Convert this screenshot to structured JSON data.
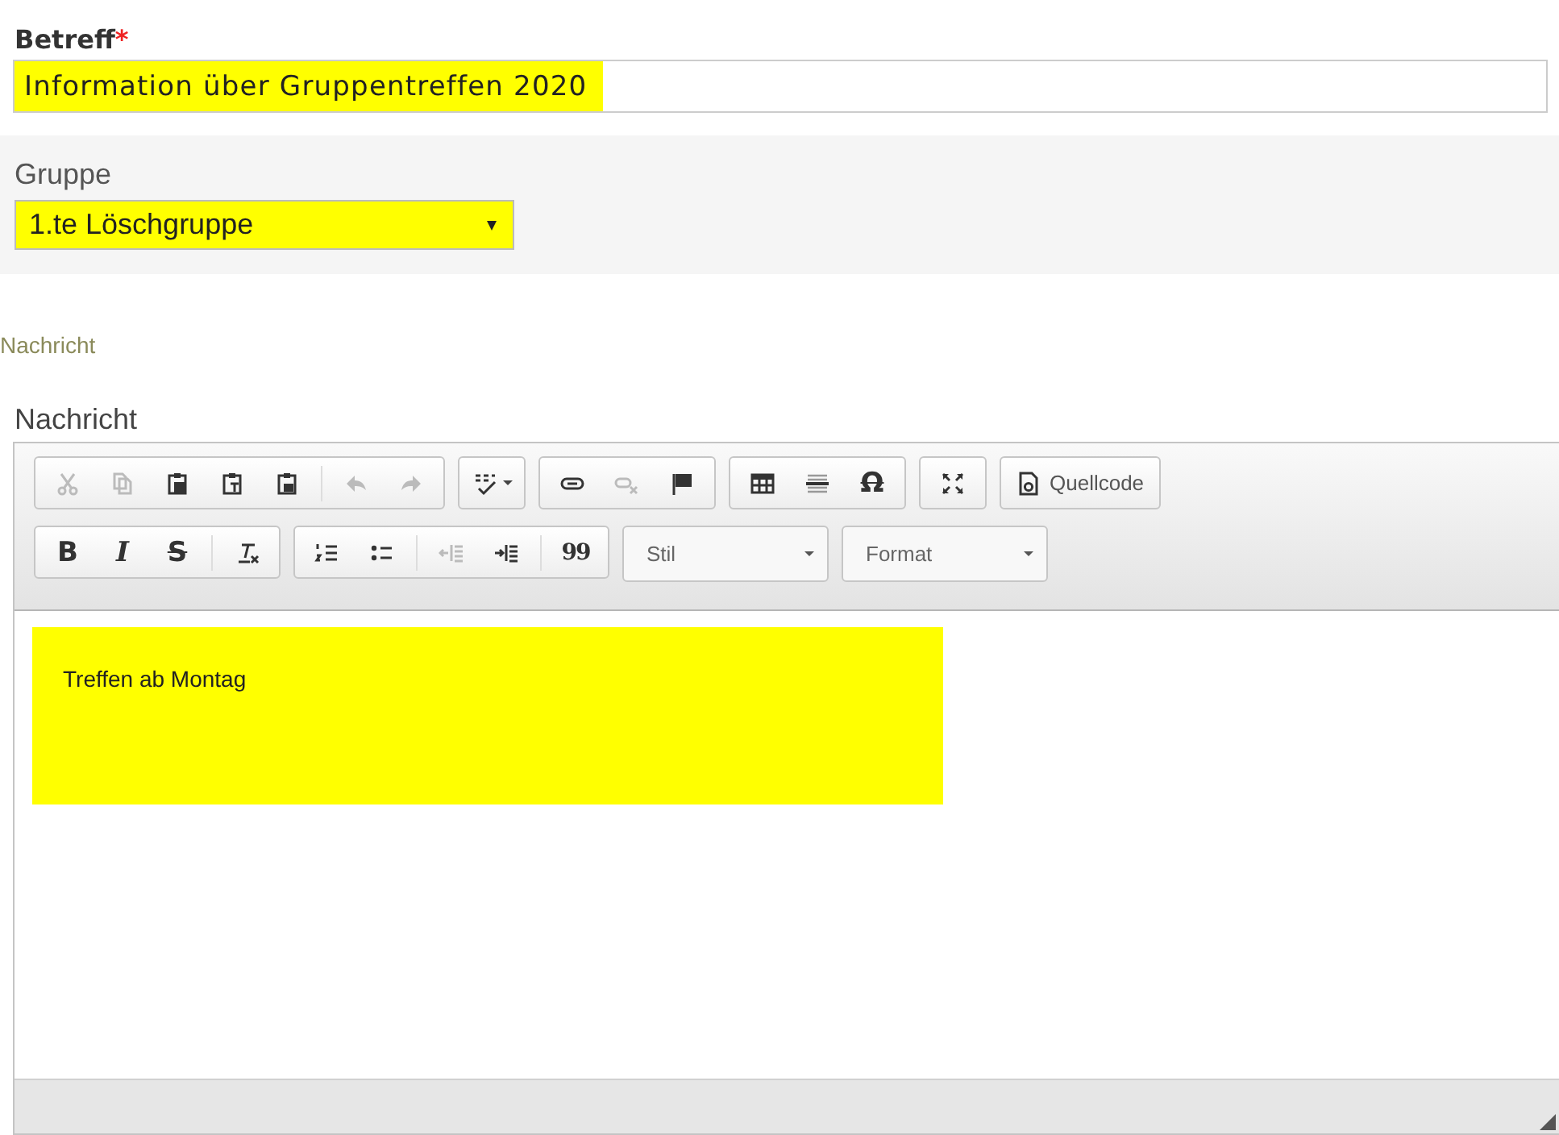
{
  "subject": {
    "label": "Betreff",
    "required_mark": "*",
    "value": "Information über Gruppentreffen 2020",
    "highlighted": true
  },
  "group": {
    "label": "Gruppe",
    "value": "1.te Löschgruppe",
    "highlighted": true
  },
  "section_caption": "Nachricht",
  "editor": {
    "label": "Nachricht",
    "toolbar_rows": [
      [
        [
          {
            "kind": "icon",
            "disabled": true
          },
          {
            "kind": "icon",
            "disabled": true
          },
          {
            "kind": "icon",
            "disabled": false
          },
          {
            "kind": "icon",
            "disabled": false
          },
          {
            "kind": "icon",
            "disabled": false
          },
          {
            "kind": "separator"
          },
          {
            "kind": "icon",
            "disabled": true
          },
          {
            "kind": "icon",
            "disabled": true
          }
        ],
        [
          {
            "kind": "icon",
            "disabled": false
          }
        ],
        [
          {
            "kind": "icon",
            "disabled": false
          },
          {
            "kind": "icon",
            "disabled": true
          },
          {
            "kind": "icon",
            "disabled": false
          }
        ],
        [
          {
            "kind": "icon",
            "disabled": false
          },
          {
            "kind": "icon",
            "disabled": false
          },
          {
            "kind": "letter",
            "label": "Ω",
            "disabled": false
          }
        ],
        [
          {
            "kind": "icon",
            "disabled": false
          }
        ],
        [
          {
            "kind": "labeled",
            "label": "Quellcode",
            "disabled": false
          }
        ]
      ],
      [
        [
          {
            "kind": "letter",
            "label": "B",
            "disabled": false
          },
          {
            "kind": "letter",
            "label": "I",
            "disabled": false
          },
          {
            "kind": "letter",
            "label": "S",
            "disabled": false
          },
          {
            "kind": "separator"
          },
          {
            "kind": "icon",
            "disabled": false
          }
        ],
        [
          {
            "kind": "icon",
            "disabled": false
          },
          {
            "kind": "icon",
            "disabled": false
          },
          {
            "kind": "separator"
          },
          {
            "kind": "icon",
            "disabled": true
          },
          {
            "kind": "icon",
            "disabled": false
          },
          {
            "kind": "separator"
          },
          {
            "kind": "letter",
            "label": "99",
            "disabled": false
          }
        ],
        [
          {
            "kind": "combo",
            "label": "Stil"
          }
        ],
        [
          {
            "kind": "combo",
            "label": "Format"
          }
        ]
      ]
    ],
    "content": {
      "text": "Treffen ab Montag",
      "highlighted": true
    }
  }
}
